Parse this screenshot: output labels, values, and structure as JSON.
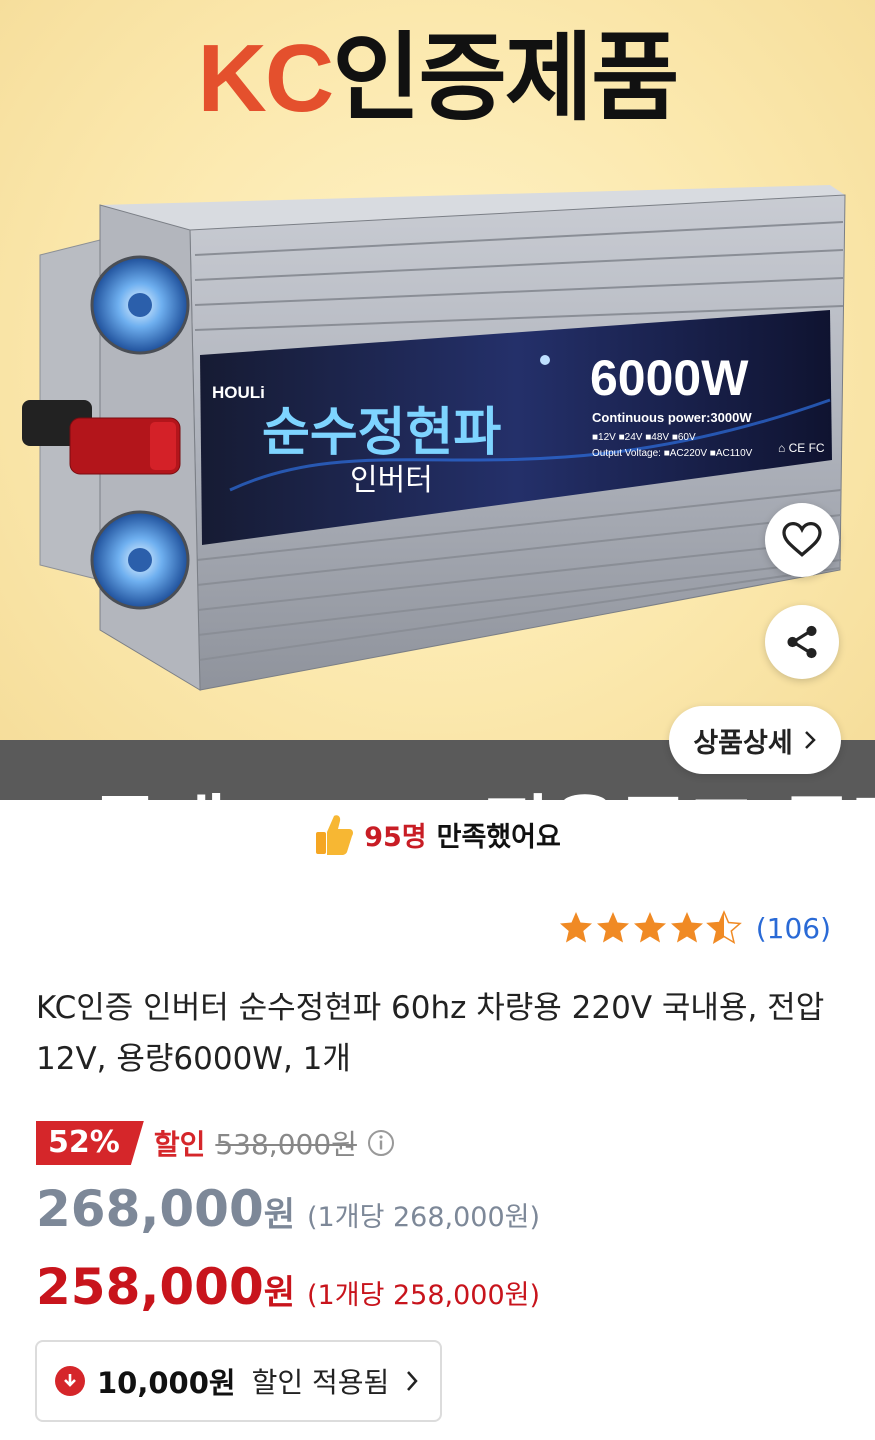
{
  "hero": {
    "title_kc": "KC",
    "title_rest": "인증제품",
    "brand": "HOULi",
    "product_name": "순수정현파",
    "product_sub": "인버터",
    "wattage": "6000W",
    "continuous": "Continuous power:3000W",
    "voltages": "■12V  ■24V  ■48V  ■60V",
    "output": "Output Voltage: ■AC220V ■AC110V",
    "certs": "⌂ CE FC",
    "bottom_banner": "국내 AS + 전용퓨즈 증정",
    "detail_label": "상품상세"
  },
  "satisfaction": {
    "count": "95명",
    "text": "만족했어요"
  },
  "rating": {
    "stars": 4.5,
    "count": "(106)"
  },
  "product": {
    "title": "KC인증 인버터 순수정현파 60hz 차량용 220V 국내용, 전압12V, 용량6000W, 1개"
  },
  "pricing": {
    "discount_pct": "52%",
    "discount_label": "할인",
    "original": "538,000원",
    "price": "268,000",
    "price_won": "원",
    "price_unit": "(1개당 268,000원)",
    "sale_price": "258,000",
    "sale_won": "원",
    "sale_unit": "(1개당 258,000원)"
  },
  "coupon": {
    "amount": "10,000원",
    "text": "할인 적용됨"
  },
  "colors": {
    "accent_red": "#d5262a",
    "link_blue": "#2a6ad6",
    "star": "#f08a24"
  }
}
